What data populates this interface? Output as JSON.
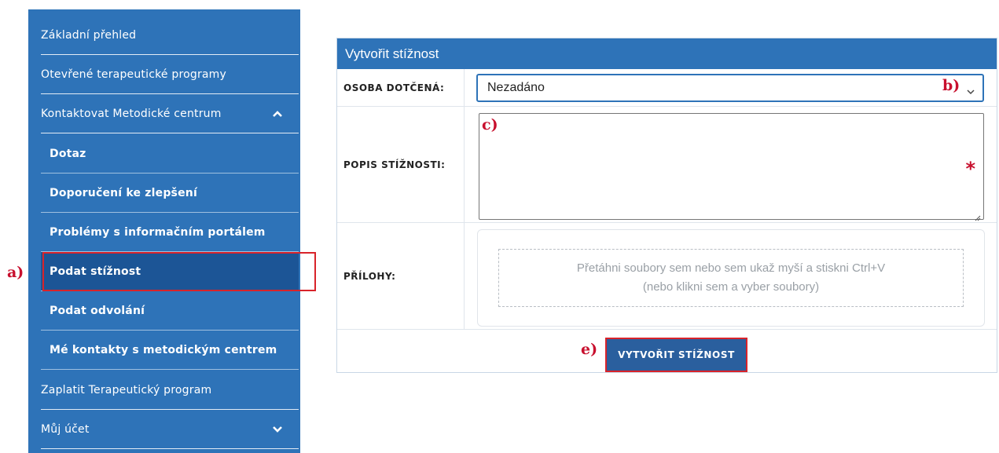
{
  "sidebar": {
    "items": [
      {
        "label": "Základní přehled"
      },
      {
        "label": "Otevřené terapeutické programy"
      },
      {
        "label": "Kontaktovat Metodické centrum"
      },
      {
        "label": "Dotaz"
      },
      {
        "label": "Doporučení ke zlepšení"
      },
      {
        "label": "Problémy s informačním portálem"
      },
      {
        "label": "Podat stížnost"
      },
      {
        "label": "Podat odvolání"
      },
      {
        "label": "Mé kontakty s metodickým centrem"
      },
      {
        "label": "Zaplatit Terapeutický program"
      },
      {
        "label": "Můj účet"
      }
    ]
  },
  "annotations": {
    "a": "a)",
    "b": "b)",
    "c": "c)",
    "e": "e)"
  },
  "form": {
    "title": "Vytvořit stížnost",
    "person_label": "OSOBA DOTČENÁ:",
    "person_value": "Nezadáno",
    "description_label": "POPIS STÍŽNOSTI:",
    "required_mark": "*",
    "attachments_label": "PŘÍLOHY:",
    "dropzone_line1": "Přetáhni soubory sem nebo sem ukaž myší a stiskni Ctrl+V",
    "dropzone_line2": "(nebo klikni sem a vyber soubory)",
    "submit_label": "VYTVOŘIT STÍŽNOST"
  },
  "colors": {
    "sidebar_bg": "#2e73b8",
    "sidebar_active": "#1c5596",
    "header_bg": "#2e73b8",
    "submit_bg": "#2a5f9e",
    "annotation_red": "#c8102e"
  }
}
